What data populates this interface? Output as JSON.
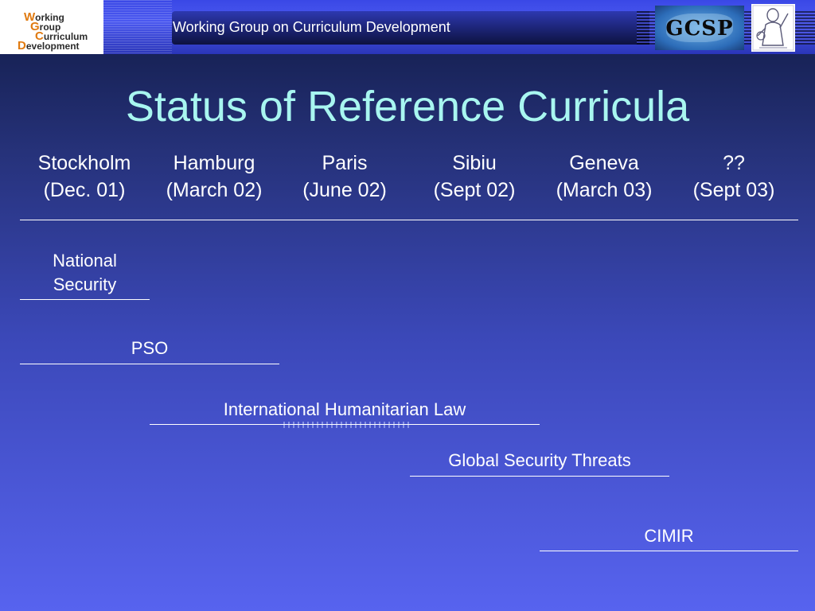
{
  "header": {
    "title": "Working Group on Curriculum Development",
    "logo_lines": [
      "Working",
      "Group",
      "Curriculum",
      "Development"
    ],
    "right_logo_text": "GCSP"
  },
  "slide": {
    "title": "Status of Reference Curricula",
    "columns": [
      {
        "city": "Stockholm",
        "date": "(Dec. 01)"
      },
      {
        "city": "Hamburg",
        "date": "(March 02)"
      },
      {
        "city": "Paris",
        "date": "(June 02)"
      },
      {
        "city": "Sibiu",
        "date": "(Sept 02)"
      },
      {
        "city": "Geneva",
        "date": "(March 03)"
      },
      {
        "city": "??",
        "date": "(Sept 03)"
      }
    ],
    "tracks": [
      {
        "label_line1": "National",
        "label_line2": "Security"
      },
      {
        "label": "PSO"
      },
      {
        "label": "International Humanitarian Law"
      },
      {
        "label": "Global Security Threats"
      },
      {
        "label": "CIMIR"
      }
    ]
  },
  "colors": {
    "title": "#a8f6f0",
    "background_top": "#101a44",
    "background_bottom": "#5763ef",
    "logo_accent": "#e07a10"
  }
}
